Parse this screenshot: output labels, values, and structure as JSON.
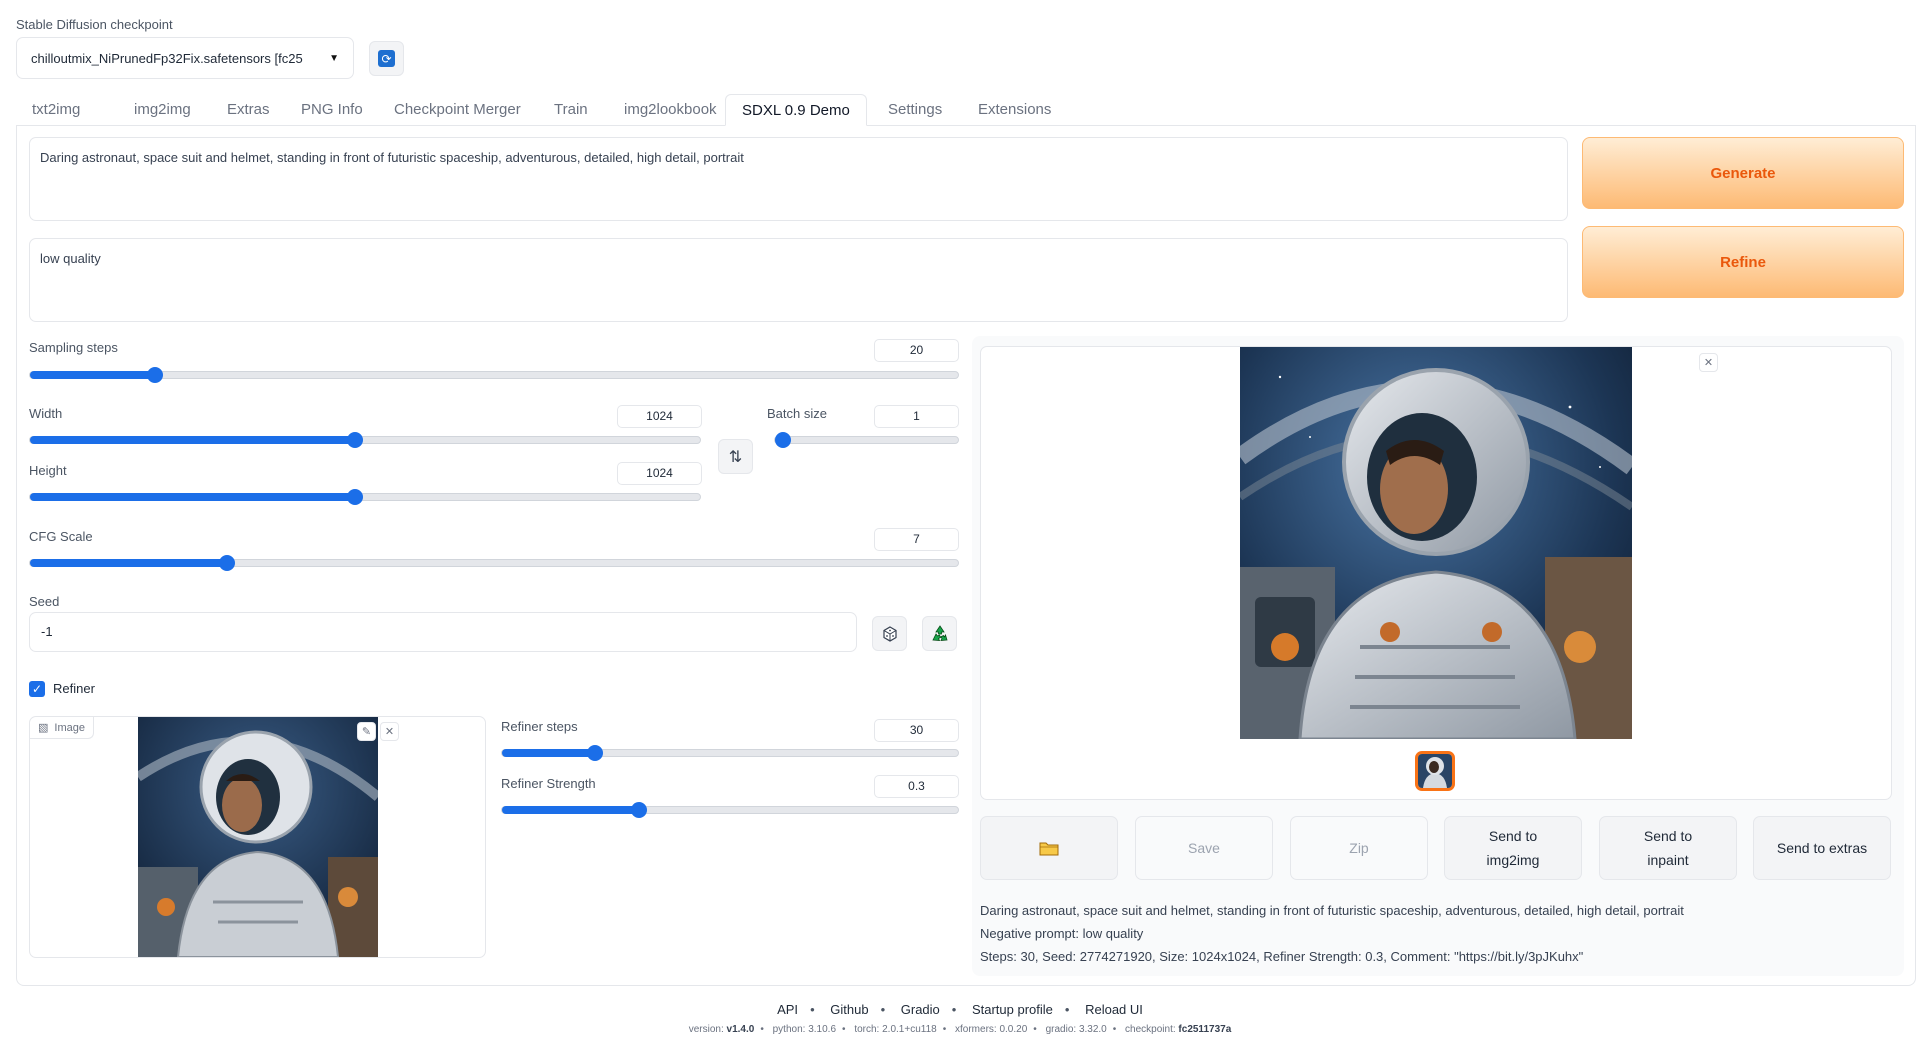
{
  "checkpoint": {
    "label": "Stable Diffusion checkpoint",
    "value": "chilloutmix_NiPrunedFp32Fix.safetensors [fc25"
  },
  "tabs": [
    {
      "label": "txt2img"
    },
    {
      "label": "img2img"
    },
    {
      "label": "Extras"
    },
    {
      "label": "PNG Info"
    },
    {
      "label": "Checkpoint Merger"
    },
    {
      "label": "Train"
    },
    {
      "label": "img2lookbook"
    },
    {
      "label": "SDXL 0.9 Demo",
      "active": true
    },
    {
      "label": "Settings"
    },
    {
      "label": "Extensions"
    }
  ],
  "prompt": {
    "positive": "Daring astronaut, space suit and helmet, standing in front of futuristic spaceship, adventurous, detailed, high detail, portrait",
    "negative": "low quality"
  },
  "buttons": {
    "generate": "Generate",
    "refine": "Refine"
  },
  "params": {
    "sampling_steps": {
      "label": "Sampling steps",
      "value": "20",
      "fraction": 0.135
    },
    "width": {
      "label": "Width",
      "value": "1024",
      "fraction": 0.485
    },
    "height": {
      "label": "Height",
      "value": "1024",
      "fraction": 0.485
    },
    "batch_size": {
      "label": "Batch size",
      "value": "1",
      "fraction": 0.0
    },
    "cfg_scale": {
      "label": "CFG Scale",
      "value": "7",
      "fraction": 0.212
    },
    "seed": {
      "label": "Seed",
      "value": "-1"
    }
  },
  "refiner": {
    "label": "Refiner",
    "checked": true,
    "image_tag": "Image",
    "steps": {
      "label": "Refiner steps",
      "value": "30",
      "fraction": 0.205
    },
    "strength": {
      "label": "Refiner Strength",
      "value": "0.3",
      "fraction": 0.3
    }
  },
  "actions": [
    {
      "label": "",
      "icon": "folder-icon",
      "name": "open-folder-button"
    },
    {
      "label": "Save",
      "dim": true,
      "name": "save-button"
    },
    {
      "label": "Zip",
      "dim": true,
      "name": "zip-button"
    },
    {
      "label": "Send to img2img",
      "name": "send-to-img2img-button"
    },
    {
      "label": "Send to inpaint",
      "name": "send-to-inpaint-button"
    },
    {
      "label": "Send to extras",
      "name": "send-to-extras-button"
    }
  ],
  "info": {
    "prompt": "Daring astronaut, space suit and helmet, standing in front of futuristic spaceship, adventurous, detailed, high detail, portrait",
    "negative": "Negative prompt: low quality",
    "params": "Steps: 30, Seed: 2774271920, Size: 1024x1024, Refiner Strength: 0.3, Comment: \"https://bit.ly/3pJKuhx\""
  },
  "footer": {
    "links": [
      "API",
      "Github",
      "Gradio",
      "Startup profile",
      "Reload UI"
    ],
    "versions": [
      {
        "key": "version:",
        "val": "v1.4.0",
        "bold": true
      },
      {
        "key": "python:",
        "val": "3.10.6"
      },
      {
        "key": "torch:",
        "val": "2.0.1+cu118"
      },
      {
        "key": "xformers:",
        "val": "0.0.20"
      },
      {
        "key": "gradio:",
        "val": "3.32.0"
      },
      {
        "key": "checkpoint:",
        "val": "fc2511737a",
        "bold": true
      }
    ]
  },
  "colors": {
    "accent": "#1b6ee8",
    "primary_button": "#fdba74",
    "primary_text": "#ea580c",
    "selected_thumb": "#f97316"
  }
}
